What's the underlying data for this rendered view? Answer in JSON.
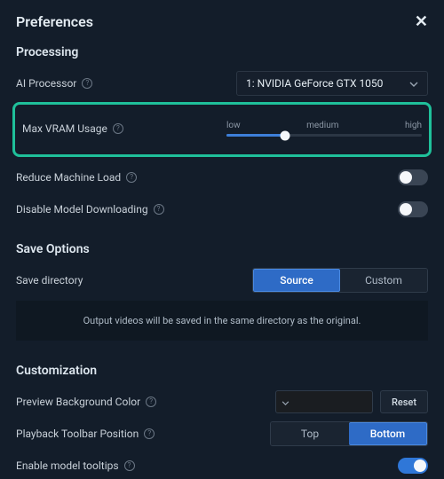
{
  "window": {
    "title": "Preferences"
  },
  "sections": {
    "processing": {
      "title": "Processing",
      "ai_processor_label": "AI Processor",
      "ai_processor_value": "1: NVIDIA GeForce GTX 1050",
      "max_vram_label": "Max VRAM Usage",
      "vram_ticks": {
        "low": "low",
        "medium": "medium",
        "high": "high"
      },
      "reduce_load_label": "Reduce Machine Load",
      "disable_download_label": "Disable Model Downloading"
    },
    "save": {
      "title": "Save Options",
      "dir_label": "Save directory",
      "seg": {
        "source": "Source",
        "custom": "Custom"
      },
      "info": "Output videos will be saved in the same directory as the original."
    },
    "custom": {
      "title": "Customization",
      "bg_label": "Preview Background Color",
      "reset": "Reset",
      "toolbar_pos_label": "Playback Toolbar Position",
      "pos": {
        "top": "Top",
        "bottom": "Bottom"
      },
      "tooltips_label": "Enable model tooltips"
    }
  }
}
